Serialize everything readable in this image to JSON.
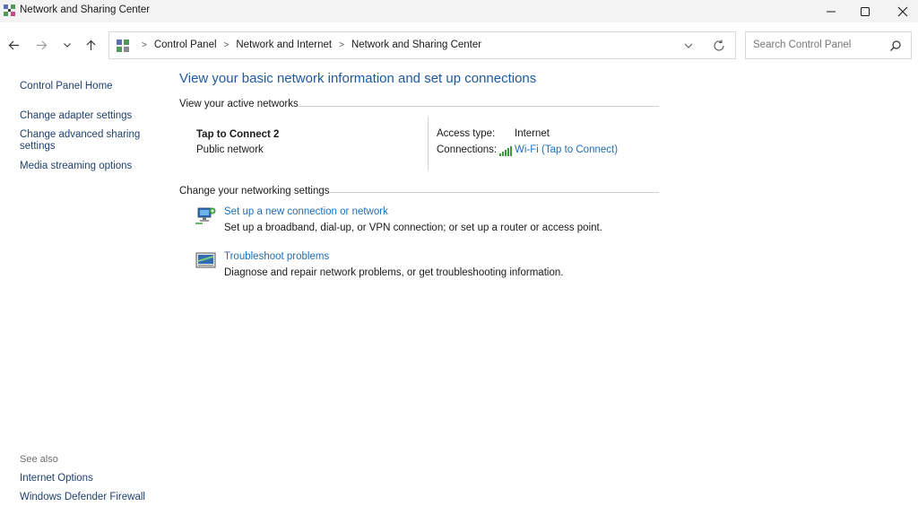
{
  "window": {
    "title": "Network and Sharing Center",
    "icon": "network-sharing-icon"
  },
  "address_bar": {
    "breadcrumbs": [
      "Control Panel",
      "Network and Internet",
      "Network and Sharing Center"
    ],
    "search_placeholder": "Search Control Panel"
  },
  "sidebar": {
    "home": "Control Panel Home",
    "links": [
      "Change adapter settings",
      "Change advanced sharing settings",
      "Media streaming options"
    ],
    "see_also_heading": "See also",
    "see_also": [
      "Internet Options",
      "Windows Defender Firewall"
    ]
  },
  "main": {
    "title": "View your basic network information and set up connections",
    "active_heading": "View your active networks",
    "network": {
      "name": "Tap to Connect 2",
      "category": "Public network",
      "access_label": "Access type:",
      "access_value": "Internet",
      "connections_label": "Connections:",
      "connections_value": "Wi-Fi (Tap to Connect)"
    },
    "change_heading": "Change your networking settings",
    "tasks": [
      {
        "title": "Set up a new connection or network",
        "desc": "Set up a broadband, dial-up, or VPN connection; or set up a router or access point.",
        "icon": "new-connection-icon"
      },
      {
        "title": "Troubleshoot problems",
        "desc": "Diagnose and repair network problems, or get troubleshooting information.",
        "icon": "troubleshoot-icon"
      }
    ]
  },
  "colors": {
    "link": "#1e6fb8",
    "title_blue": "#1e5aa0",
    "titlebar": "#f3f3f3"
  }
}
